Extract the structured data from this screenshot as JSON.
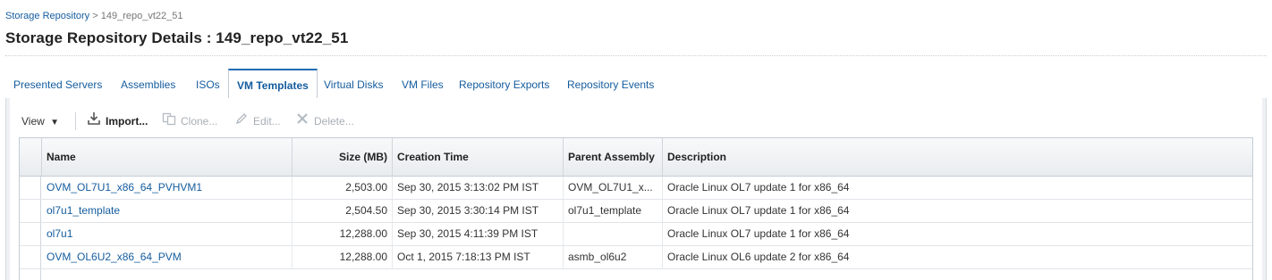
{
  "breadcrumb": {
    "parent": "Storage Repository",
    "separator": " > ",
    "current": "149_repo_vt22_51"
  },
  "page_title": "Storage Repository Details : 149_repo_vt22_51",
  "tabs": [
    {
      "label": "Presented Servers"
    },
    {
      "label": "Assemblies"
    },
    {
      "label": "ISOs"
    },
    {
      "label": "VM Templates",
      "active": true
    },
    {
      "label": "Virtual Disks"
    },
    {
      "label": "VM Files"
    },
    {
      "label": "Repository Exports"
    },
    {
      "label": "Repository Events"
    }
  ],
  "toolbar": {
    "view_label": "View",
    "import_label": "Import...",
    "clone_label": "Clone...",
    "edit_label": "Edit...",
    "delete_label": "Delete..."
  },
  "table": {
    "columns": [
      "Name",
      "Size (MB)",
      "Creation Time",
      "Parent Assembly",
      "Description"
    ],
    "rows": [
      {
        "name": "OVM_OL7U1_x86_64_PVHVM1",
        "size": "2,503.00",
        "created": "Sep 30, 2015 3:13:02 PM IST",
        "parent": "OVM_OL7U1_x...",
        "description": "Oracle Linux OL7 update 1 for x86_64"
      },
      {
        "name": "ol7u1_template",
        "size": "2,504.50",
        "created": "Sep 30, 2015 3:30:14 PM IST",
        "parent": "ol7u1_template",
        "description": "Oracle Linux OL7 update 1 for x86_64"
      },
      {
        "name": "ol7u1",
        "size": "12,288.00",
        "created": "Sep 30, 2015 4:11:39 PM IST",
        "parent": "",
        "description": "Oracle Linux OL7 update 1 for x86_64"
      },
      {
        "name": "OVM_OL6U2_x86_64_PVM",
        "size": "12,288.00",
        "created": "Oct 1, 2015 7:18:13 PM IST",
        "parent": "asmb_ol6u2",
        "description": "Oracle Linux OL6 update 2 for x86_64"
      }
    ]
  },
  "colors": {
    "link": "#145c9e",
    "active_tab_border": "#1f6bb3",
    "disabled": "#a8aeb5"
  }
}
